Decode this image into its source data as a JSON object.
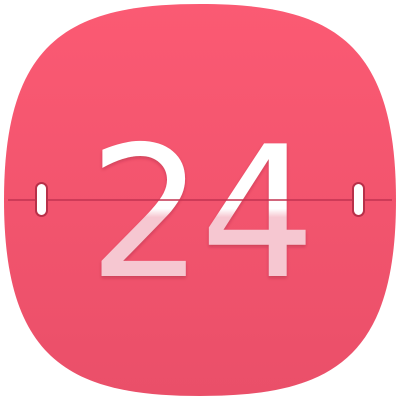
{
  "app_icon": {
    "day_number": "24",
    "icon_name": "calendar-flip-icon",
    "colors": {
      "background_top": "#fb5a73",
      "background_bottom": "#ea4f69",
      "digit_top": "#ffffff",
      "digit_bottom": "#f6c7d1",
      "divider_line": "#c23350",
      "hinge_fill": "#ffffff",
      "hinge_stroke": "#b83049"
    }
  }
}
